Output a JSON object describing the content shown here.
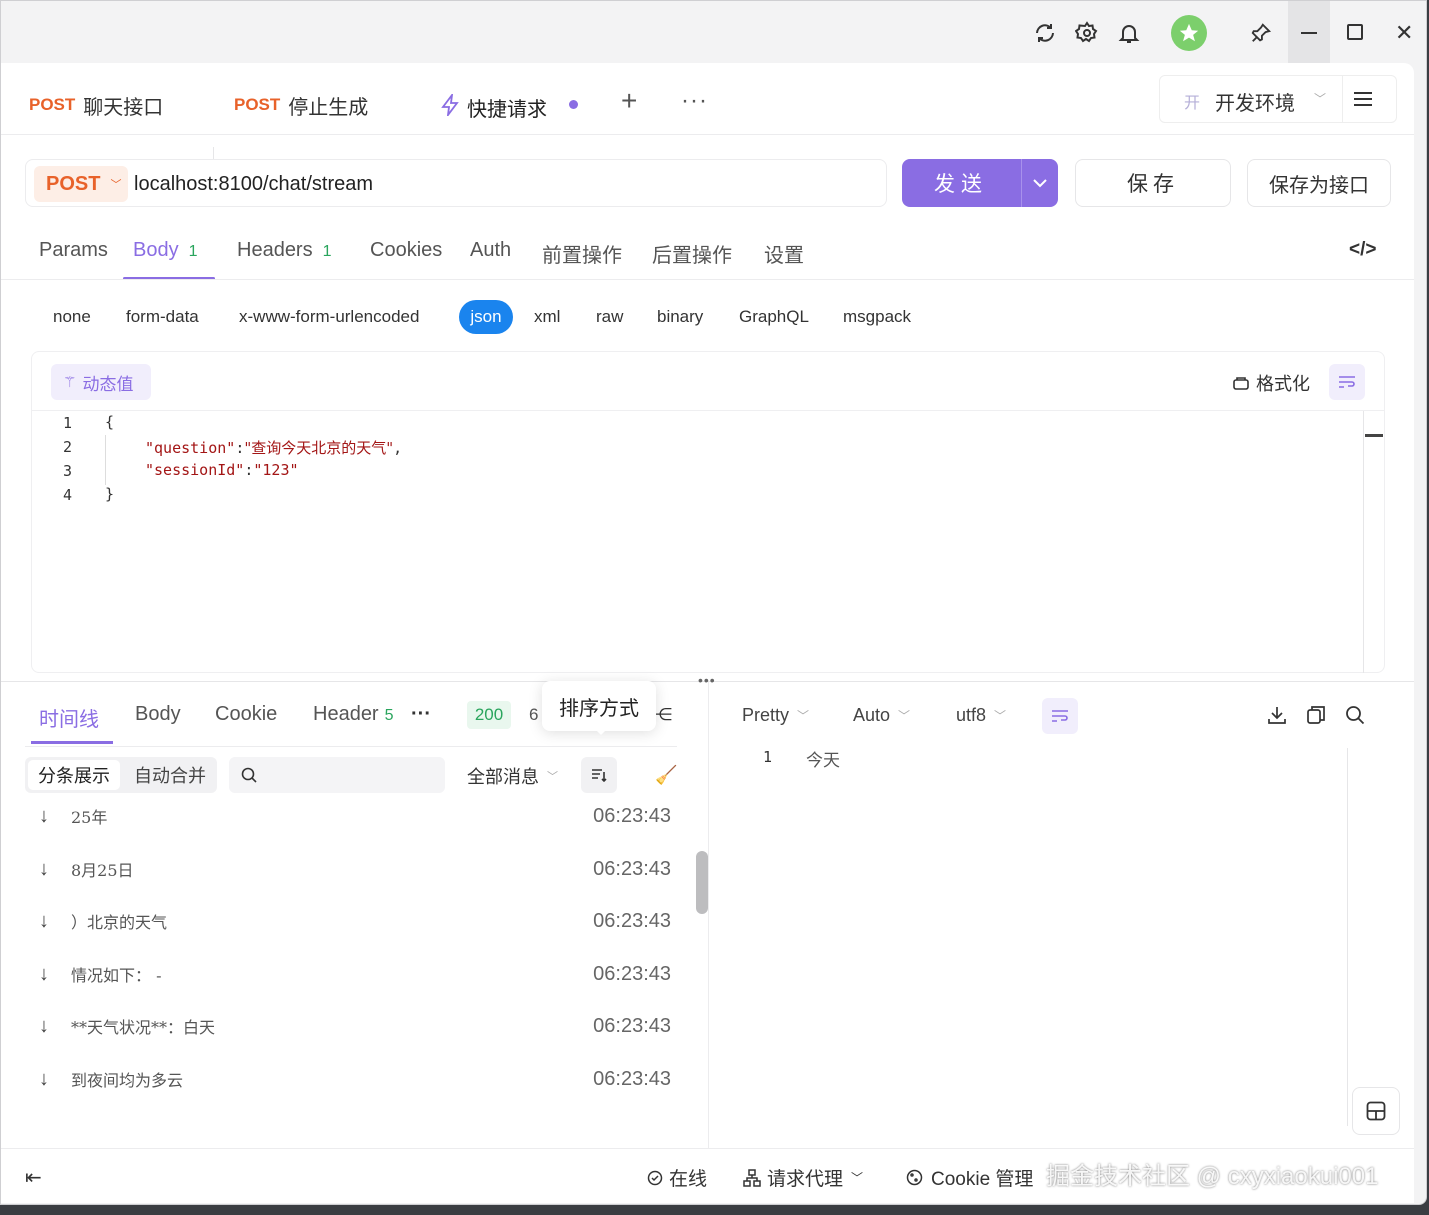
{
  "tabs": [
    {
      "method": "POST",
      "label": "聊天接口"
    },
    {
      "method": "POST",
      "label": "停止生成"
    },
    {
      "label": "快捷请求"
    }
  ],
  "env": {
    "prefix": "开",
    "label": "开发环境"
  },
  "request": {
    "method": "POST",
    "url": "localhost:8100/chat/stream"
  },
  "actions": {
    "send": "发送",
    "save": "保存",
    "save_as": "保存为接口"
  },
  "req_tabs": [
    {
      "label": "Params"
    },
    {
      "label": "Body",
      "count": "1"
    },
    {
      "label": "Headers",
      "count": "1"
    },
    {
      "label": "Cookies"
    },
    {
      "label": "Auth"
    },
    {
      "label": "前置操作"
    },
    {
      "label": "后置操作"
    },
    {
      "label": "设置"
    }
  ],
  "body_types": [
    "none",
    "form-data",
    "x-www-form-urlencoded",
    "json",
    "xml",
    "raw",
    "binary",
    "GraphQL",
    "msgpack"
  ],
  "editor": {
    "dynamic_label": "动态值",
    "format_label": "格式化",
    "line_numbers": [
      "1",
      "2",
      "3",
      "4"
    ],
    "lines": {
      "open": "{",
      "q_key": "\"question\"",
      "q_colon": ":",
      "q_val": "\"查询今天北京的天气\"",
      "q_comma": ",",
      "s_key": "\"sessionId\"",
      "s_colon": ":",
      "s_val": "\"123\"",
      "close": "}"
    }
  },
  "resp_tabs": {
    "timeline": "时间线",
    "body": "Body",
    "cookie": "Cookie",
    "header": "Header",
    "header_count": "5",
    "status": "200",
    "partial": "6"
  },
  "tooltip": "排序方式",
  "timeline": {
    "mode_split": "分条展示",
    "mode_merge": "自动合并",
    "filter": "全部消息",
    "items": [
      {
        "text": "25年",
        "time": "06:23:43"
      },
      {
        "text": "8月25日",
        "time": "06:23:43"
      },
      {
        "text": "）北京的天气",
        "time": "06:23:43"
      },
      {
        "text": "情况如下：  -",
        "time": "06:23:43"
      },
      {
        "text": "**天气状况**：白天",
        "time": "06:23:43"
      },
      {
        "text": "到夜间均为多云",
        "time": "06:23:43"
      }
    ]
  },
  "viewer": {
    "pretty": "Pretty",
    "auto": "Auto",
    "enc": "utf8",
    "line_no": "1",
    "content": "今天"
  },
  "footer": {
    "online": "在线",
    "proxy": "请求代理",
    "cookie": "Cookie 管理"
  },
  "watermark": "掘金技术社区 @ cxyxiaokui001",
  "colors": {
    "accent": "#8a6de3",
    "method": "#e8622a",
    "ok": "#2aa55d"
  }
}
